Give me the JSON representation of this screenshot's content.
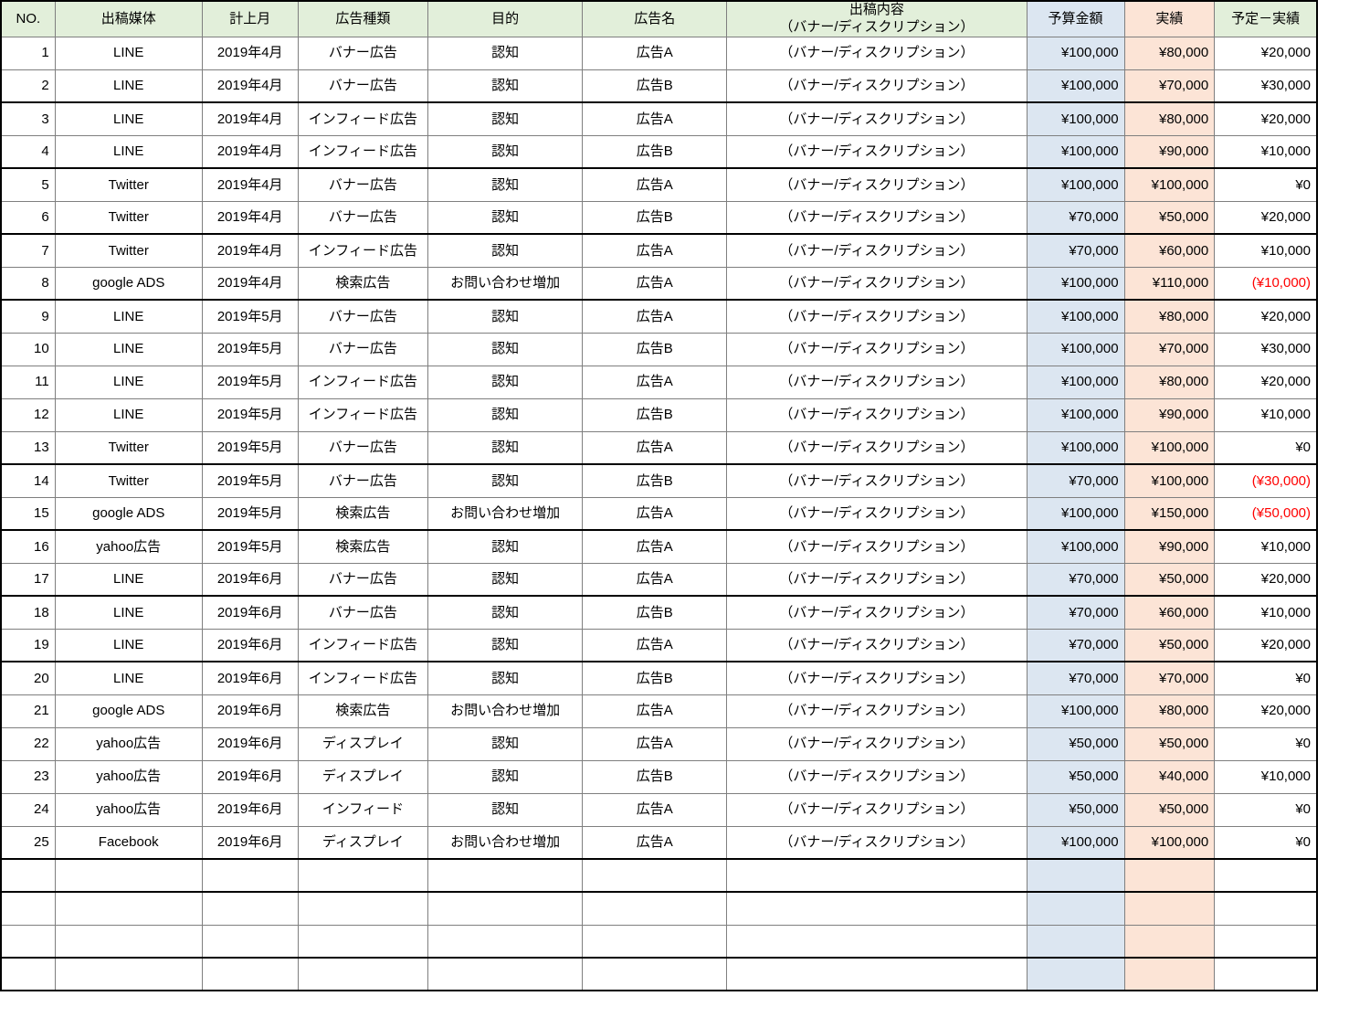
{
  "table": {
    "columns": [
      {
        "key": "no",
        "label": "NO.",
        "header_bg": "#e2efda"
      },
      {
        "key": "media",
        "label": "出稿媒体",
        "header_bg": "#e2efda"
      },
      {
        "key": "month",
        "label": "計上月",
        "header_bg": "#e2efda"
      },
      {
        "key": "adtype",
        "label": "広告種類",
        "header_bg": "#e2efda"
      },
      {
        "key": "purpose",
        "label": "目的",
        "header_bg": "#e2efda"
      },
      {
        "key": "adname",
        "label": "広告名",
        "header_bg": "#e2efda"
      },
      {
        "key": "content",
        "label": "出稿内容",
        "label2": "（バナー/ディスクリプション）",
        "header_bg": "#e2efda"
      },
      {
        "key": "budget",
        "label": "予算金額",
        "header_bg": "#dce6f1"
      },
      {
        "key": "actual",
        "label": "実績",
        "header_bg": "#fce4d6"
      },
      {
        "key": "diff",
        "label": "予定－実績",
        "header_bg": "#e2efda"
      }
    ],
    "colors": {
      "header_green": "#e2efda",
      "budget_blue": "#dce6f1",
      "actual_orange": "#fce4d6",
      "negative_text": "#ff0000",
      "grid_line": "#7f7f7f",
      "heavy_line": "#000000"
    },
    "rows": [
      {
        "no": "1",
        "media": "LINE",
        "month": "2019年4月",
        "adtype": "バナー広告",
        "purpose": "認知",
        "adname": "広告A",
        "content": "（バナー/ディスクリプション）",
        "budget": "¥100,000",
        "actual": "¥80,000",
        "diff": "¥20,000",
        "diff_negative": false,
        "thick_top": false
      },
      {
        "no": "2",
        "media": "LINE",
        "month": "2019年4月",
        "adtype": "バナー広告",
        "purpose": "認知",
        "adname": "広告B",
        "content": "（バナー/ディスクリプション）",
        "budget": "¥100,000",
        "actual": "¥70,000",
        "diff": "¥30,000",
        "diff_negative": false,
        "thick_top": false
      },
      {
        "no": "3",
        "media": "LINE",
        "month": "2019年4月",
        "adtype": "インフィード広告",
        "purpose": "認知",
        "adname": "広告A",
        "content": "（バナー/ディスクリプション）",
        "budget": "¥100,000",
        "actual": "¥80,000",
        "diff": "¥20,000",
        "diff_negative": false,
        "thick_top": true
      },
      {
        "no": "4",
        "media": "LINE",
        "month": "2019年4月",
        "adtype": "インフィード広告",
        "purpose": "認知",
        "adname": "広告B",
        "content": "（バナー/ディスクリプション）",
        "budget": "¥100,000",
        "actual": "¥90,000",
        "diff": "¥10,000",
        "diff_negative": false,
        "thick_top": false
      },
      {
        "no": "5",
        "media": "Twitter",
        "month": "2019年4月",
        "adtype": "バナー広告",
        "purpose": "認知",
        "adname": "広告A",
        "content": "（バナー/ディスクリプション）",
        "budget": "¥100,000",
        "actual": "¥100,000",
        "diff": "¥0",
        "diff_negative": false,
        "thick_top": true
      },
      {
        "no": "6",
        "media": "Twitter",
        "month": "2019年4月",
        "adtype": "バナー広告",
        "purpose": "認知",
        "adname": "広告B",
        "content": "（バナー/ディスクリプション）",
        "budget": "¥70,000",
        "actual": "¥50,000",
        "diff": "¥20,000",
        "diff_negative": false,
        "thick_top": false
      },
      {
        "no": "7",
        "media": "Twitter",
        "month": "2019年4月",
        "adtype": "インフィード広告",
        "purpose": "認知",
        "adname": "広告A",
        "content": "（バナー/ディスクリプション）",
        "budget": "¥70,000",
        "actual": "¥60,000",
        "diff": "¥10,000",
        "diff_negative": false,
        "thick_top": true
      },
      {
        "no": "8",
        "media": "google ADS",
        "month": "2019年4月",
        "adtype": "検索広告",
        "purpose": "お問い合わせ増加",
        "adname": "広告A",
        "content": "（バナー/ディスクリプション）",
        "budget": "¥100,000",
        "actual": "¥110,000",
        "diff": "(¥10,000)",
        "diff_negative": true,
        "thick_top": false
      },
      {
        "no": "9",
        "media": "LINE",
        "month": "2019年5月",
        "adtype": "バナー広告",
        "purpose": "認知",
        "adname": "広告A",
        "content": "（バナー/ディスクリプション）",
        "budget": "¥100,000",
        "actual": "¥80,000",
        "diff": "¥20,000",
        "diff_negative": false,
        "thick_top": true
      },
      {
        "no": "10",
        "media": "LINE",
        "month": "2019年5月",
        "adtype": "バナー広告",
        "purpose": "認知",
        "adname": "広告B",
        "content": "（バナー/ディスクリプション）",
        "budget": "¥100,000",
        "actual": "¥70,000",
        "diff": "¥30,000",
        "diff_negative": false,
        "thick_top": false
      },
      {
        "no": "11",
        "media": "LINE",
        "month": "2019年5月",
        "adtype": "インフィード広告",
        "purpose": "認知",
        "adname": "広告A",
        "content": "（バナー/ディスクリプション）",
        "budget": "¥100,000",
        "actual": "¥80,000",
        "diff": "¥20,000",
        "diff_negative": false,
        "thick_top": false
      },
      {
        "no": "12",
        "media": "LINE",
        "month": "2019年5月",
        "adtype": "インフィード広告",
        "purpose": "認知",
        "adname": "広告B",
        "content": "（バナー/ディスクリプション）",
        "budget": "¥100,000",
        "actual": "¥90,000",
        "diff": "¥10,000",
        "diff_negative": false,
        "thick_top": false
      },
      {
        "no": "13",
        "media": "Twitter",
        "month": "2019年5月",
        "adtype": "バナー広告",
        "purpose": "認知",
        "adname": "広告A",
        "content": "（バナー/ディスクリプション）",
        "budget": "¥100,000",
        "actual": "¥100,000",
        "diff": "¥0",
        "diff_negative": false,
        "thick_top": false
      },
      {
        "no": "14",
        "media": "Twitter",
        "month": "2019年5月",
        "adtype": "バナー広告",
        "purpose": "認知",
        "adname": "広告B",
        "content": "（バナー/ディスクリプション）",
        "budget": "¥70,000",
        "actual": "¥100,000",
        "diff": "(¥30,000)",
        "diff_negative": true,
        "thick_top": true
      },
      {
        "no": "15",
        "media": "google ADS",
        "month": "2019年5月",
        "adtype": "検索広告",
        "purpose": "お問い合わせ増加",
        "adname": "広告A",
        "content": "（バナー/ディスクリプション）",
        "budget": "¥100,000",
        "actual": "¥150,000",
        "diff": "(¥50,000)",
        "diff_negative": true,
        "thick_top": false
      },
      {
        "no": "16",
        "media": "yahoo広告",
        "month": "2019年5月",
        "adtype": "検索広告",
        "purpose": "認知",
        "adname": "広告A",
        "content": "（バナー/ディスクリプション）",
        "budget": "¥100,000",
        "actual": "¥90,000",
        "diff": "¥10,000",
        "diff_negative": false,
        "thick_top": true
      },
      {
        "no": "17",
        "media": "LINE",
        "month": "2019年6月",
        "adtype": "バナー広告",
        "purpose": "認知",
        "adname": "広告A",
        "content": "（バナー/ディスクリプション）",
        "budget": "¥70,000",
        "actual": "¥50,000",
        "diff": "¥20,000",
        "diff_negative": false,
        "thick_top": false
      },
      {
        "no": "18",
        "media": "LINE",
        "month": "2019年6月",
        "adtype": "バナー広告",
        "purpose": "認知",
        "adname": "広告B",
        "content": "（バナー/ディスクリプション）",
        "budget": "¥70,000",
        "actual": "¥60,000",
        "diff": "¥10,000",
        "diff_negative": false,
        "thick_top": true
      },
      {
        "no": "19",
        "media": "LINE",
        "month": "2019年6月",
        "adtype": "インフィード広告",
        "purpose": "認知",
        "adname": "広告A",
        "content": "（バナー/ディスクリプション）",
        "budget": "¥70,000",
        "actual": "¥50,000",
        "diff": "¥20,000",
        "diff_negative": false,
        "thick_top": false
      },
      {
        "no": "20",
        "media": "LINE",
        "month": "2019年6月",
        "adtype": "インフィード広告",
        "purpose": "認知",
        "adname": "広告B",
        "content": "（バナー/ディスクリプション）",
        "budget": "¥70,000",
        "actual": "¥70,000",
        "diff": "¥0",
        "diff_negative": false,
        "thick_top": true
      },
      {
        "no": "21",
        "media": "google ADS",
        "month": "2019年6月",
        "adtype": "検索広告",
        "purpose": "お問い合わせ増加",
        "adname": "広告A",
        "content": "（バナー/ディスクリプション）",
        "budget": "¥100,000",
        "actual": "¥80,000",
        "diff": "¥20,000",
        "diff_negative": false,
        "thick_top": false
      },
      {
        "no": "22",
        "media": "yahoo広告",
        "month": "2019年6月",
        "adtype": "ディスプレイ",
        "purpose": "認知",
        "adname": "広告A",
        "content": "（バナー/ディスクリプション）",
        "budget": "¥50,000",
        "actual": "¥50,000",
        "diff": "¥0",
        "diff_negative": false,
        "thick_top": false
      },
      {
        "no": "23",
        "media": "yahoo広告",
        "month": "2019年6月",
        "adtype": "ディスプレイ",
        "purpose": "認知",
        "adname": "広告B",
        "content": "（バナー/ディスクリプション）",
        "budget": "¥50,000",
        "actual": "¥40,000",
        "diff": "¥10,000",
        "diff_negative": false,
        "thick_top": false
      },
      {
        "no": "24",
        "media": "yahoo広告",
        "month": "2019年6月",
        "adtype": "インフィード",
        "purpose": "認知",
        "adname": "広告A",
        "content": "（バナー/ディスクリプション）",
        "budget": "¥50,000",
        "actual": "¥50,000",
        "diff": "¥0",
        "diff_negative": false,
        "thick_top": false
      },
      {
        "no": "25",
        "media": "Facebook",
        "month": "2019年6月",
        "adtype": "ディスプレイ",
        "purpose": "お問い合わせ増加",
        "adname": "広告A",
        "content": "（バナー/ディスクリプション）",
        "budget": "¥100,000",
        "actual": "¥100,000",
        "diff": "¥0",
        "diff_negative": false,
        "thick_top": false
      }
    ],
    "blank_rows": [
      {
        "thick_top": true
      },
      {
        "thick_top": true
      },
      {
        "thick_top": false
      },
      {
        "thick_top": true
      }
    ]
  }
}
